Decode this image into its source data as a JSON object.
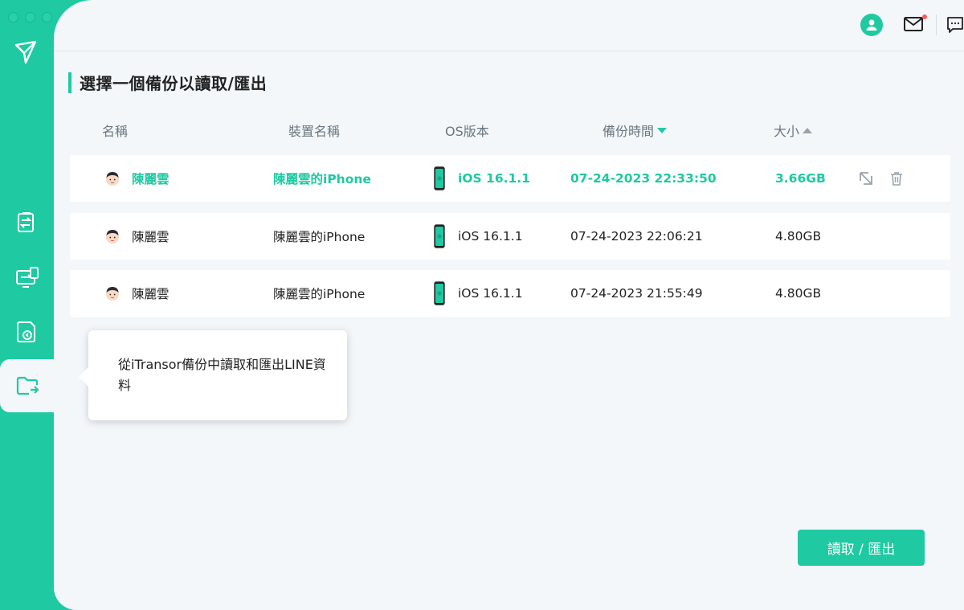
{
  "header": {
    "title": "選擇一個備份以讀取/匯出"
  },
  "table": {
    "columns": {
      "name": "名稱",
      "device": "裝置名稱",
      "os": "OS版本",
      "time": "備份時間",
      "size": "大小"
    },
    "rows": [
      {
        "name": "陳麗雲",
        "device": "陳麗雲的iPhone",
        "os": "iOS 16.1.1",
        "time": "07-24-2023 22:33:50",
        "size": "3.66GB"
      },
      {
        "name": "陳麗雲",
        "device": "陳麗雲的iPhone",
        "os": "iOS 16.1.1",
        "time": "07-24-2023 22:06:21",
        "size": "4.80GB"
      },
      {
        "name": "陳麗雲",
        "device": "陳麗雲的iPhone",
        "os": "iOS 16.1.1",
        "time": "07-24-2023 21:55:49",
        "size": "4.80GB"
      }
    ]
  },
  "tooltip": {
    "text": "從iTransor備份中讀取和匯出LINE資料"
  },
  "actions": {
    "primary_label": "讀取 / 匯出"
  },
  "colors": {
    "accent": "#1fc9a2",
    "background": "#f3f7fa"
  },
  "icons": {
    "sidebar": [
      "transfer-doc-icon",
      "device-transfer-icon",
      "restore-icon",
      "export-folder-icon"
    ],
    "top": [
      "account-icon",
      "mail-icon",
      "feedback-icon"
    ],
    "row_actions": [
      "restore-arrow-icon",
      "trash-icon"
    ]
  }
}
